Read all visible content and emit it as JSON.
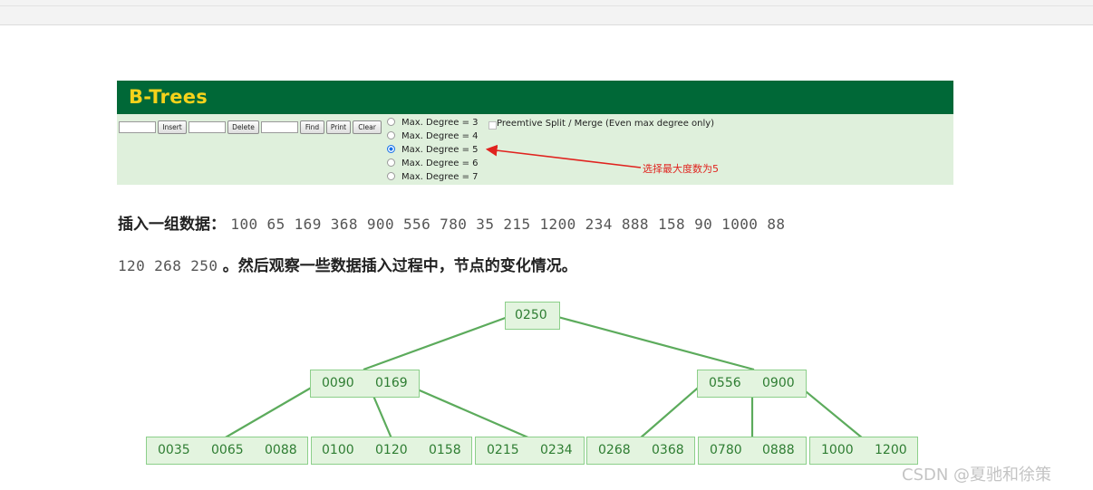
{
  "btree_app": {
    "title": "B-Trees",
    "buttons": {
      "insert": "Insert",
      "delete": "Delete",
      "find": "Find",
      "print": "Print",
      "clear": "Clear"
    },
    "inputs": {
      "insert_value": "",
      "delete_value": "",
      "find_value": ""
    },
    "degree_options": [
      "Max. Degree = 3",
      "Max. Degree = 4",
      "Max. Degree = 5",
      "Max. Degree = 6",
      "Max. Degree = 7"
    ],
    "selected_degree_index": 2,
    "preemptive_label": "Preemtive Split / Merge (Even max degree only)",
    "preemptive_checked": false,
    "annotation": "选择最大度数为5",
    "colors": {
      "header_bg": "#006837",
      "title": "#f5d21b",
      "panel_bg": "#dff0dc",
      "annotation": "#e0231f",
      "selected_radio": "#1a73e8"
    }
  },
  "article": {
    "label": "插入一组数据：",
    "numbers_line1": "100 65 169 368 900 556 780 35 215 1200 234 888 158 90 1000 88",
    "numbers_line2": "120 268 250",
    "tail": "。然后观察一些数据插入过程中，节点的变化情况。"
  },
  "tree": {
    "root": [
      "0250"
    ],
    "level1": [
      [
        "0090",
        "0169"
      ],
      [
        "0556",
        "0900"
      ]
    ],
    "leaves": [
      [
        "0035",
        "0065",
        "0088"
      ],
      [
        "0100",
        "0120",
        "0158"
      ],
      [
        "0215",
        "0234"
      ],
      [
        "0268",
        "0368"
      ],
      [
        "0780",
        "0888"
      ],
      [
        "1000",
        "1200"
      ]
    ],
    "colors": {
      "node_bg": "#e3f4df",
      "node_border": "#8ccf8a",
      "text": "#2e7d32",
      "edge": "#5cab5c"
    }
  },
  "watermark": "CSDN @夏驰和徐策"
}
